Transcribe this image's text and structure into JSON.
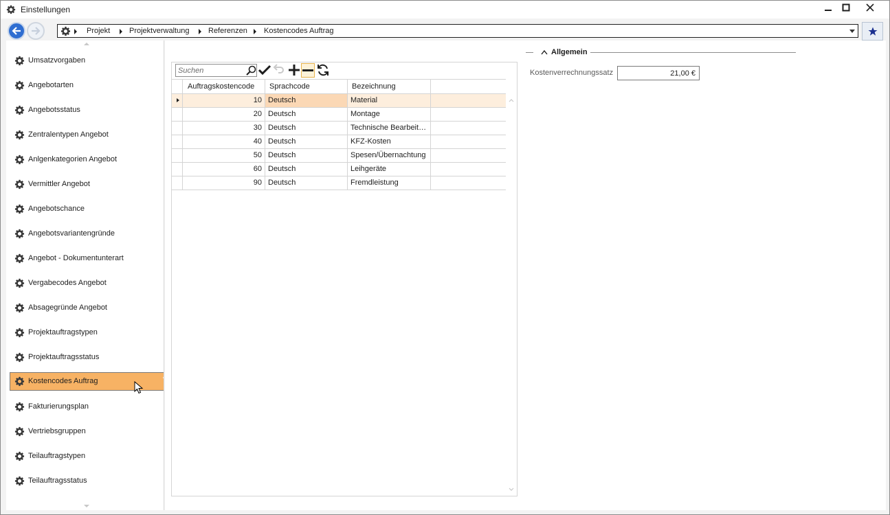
{
  "window": {
    "title": "Einstellungen",
    "minimize": "–",
    "maximize": "☐",
    "close": "✕"
  },
  "breadcrumb": {
    "items": [
      "Projekt",
      "Projektverwaltung",
      "Referenzen",
      "Kostencodes Auftrag"
    ]
  },
  "sidebar": {
    "items": [
      {
        "label": "Umsatzvorgaben"
      },
      {
        "label": "Angebotarten"
      },
      {
        "label": "Angebotsstatus"
      },
      {
        "label": "Zentralentypen Angebot"
      },
      {
        "label": "Anlgenkategorien Angebot"
      },
      {
        "label": "Vermittler Angebot"
      },
      {
        "label": "Angebotschance"
      },
      {
        "label": "Angebotsvariantengründe"
      },
      {
        "label": "Angebot - Dokumentunterart"
      },
      {
        "label": "Vergabecodes Angebot"
      },
      {
        "label": "Absagegründe Angebot"
      },
      {
        "label": "Projektauftragstypen"
      },
      {
        "label": "Projektauftragsstatus"
      },
      {
        "label": "Kostencodes Auftrag",
        "active": true
      },
      {
        "label": "Fakturierungsplan"
      },
      {
        "label": "Vertriebsgruppen"
      },
      {
        "label": "Teilauftragstypen"
      },
      {
        "label": "Teilauftragsstatus"
      }
    ]
  },
  "grid": {
    "search_placeholder": "Suchen",
    "columns": [
      "Auftragskostencode",
      "Sprachcode",
      "Bezeichnung"
    ],
    "rows": [
      {
        "code": "10",
        "lang": "Deutsch",
        "desc": "Material",
        "selected": true
      },
      {
        "code": "20",
        "lang": "Deutsch",
        "desc": "Montage"
      },
      {
        "code": "30",
        "lang": "Deutsch",
        "desc": "Technische Bearbeitu…"
      },
      {
        "code": "40",
        "lang": "Deutsch",
        "desc": "KFZ-Kosten"
      },
      {
        "code": "50",
        "lang": "Deutsch",
        "desc": "Spesen/Übernachtung"
      },
      {
        "code": "60",
        "lang": "Deutsch",
        "desc": "Leihgeräte"
      },
      {
        "code": "90",
        "lang": "Deutsch",
        "desc": "Fremdleistung"
      }
    ]
  },
  "details": {
    "section_title": "Allgemein",
    "field_label": "Kostenverrechnungssatz",
    "field_value": "21,00 €"
  },
  "colors": {
    "accent_active": "#f7b264",
    "selected_row": "#fdeedd",
    "nav_blue": "#2f6ed1"
  },
  "icons": {
    "title": "gear-icon",
    "back": "arrow-left-icon",
    "forward": "arrow-right-icon",
    "home": "gear-icon",
    "favorite": "star-icon",
    "search": "magnifier-icon",
    "save": "checkmark-icon",
    "undo": "undo-icon",
    "add": "plus-icon",
    "remove": "minus-icon",
    "refresh": "refresh-icon"
  }
}
